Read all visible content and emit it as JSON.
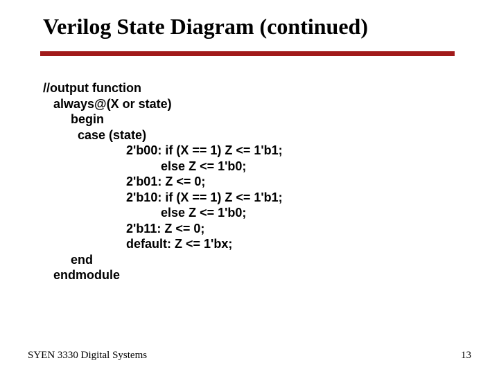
{
  "title": "Verilog State Diagram (continued)",
  "code": "//output function\n   always@(X or state)\n        begin\n          case (state)\n                        2'b00: if (X == 1) Z <= 1'b1;\n                                  else Z <= 1'b0;\n                        2'b01: Z <= 0;\n                        2'b10: if (X == 1) Z <= 1'b1;\n                                  else Z <= 1'b0;\n                        2'b11: Z <= 0;\n                        default: Z <= 1'bx;\n        end\n   endmodule",
  "footer_left": "SYEN 3330 Digital Systems",
  "footer_right": "13"
}
